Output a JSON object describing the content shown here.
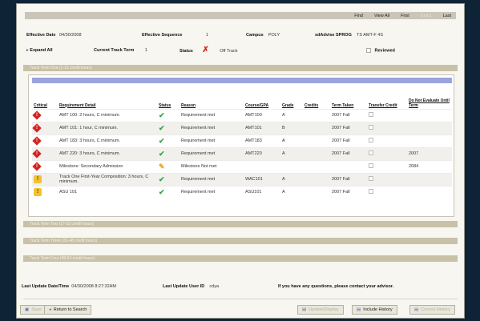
{
  "nav": {
    "find": "Find",
    "view_all": "View All",
    "first": "First",
    "counter": "1 of 1",
    "last": "Last"
  },
  "header": {
    "effective_date_label": "Effective Date",
    "effective_date": "04/30/2008",
    "effective_sequence_label": "Effective Sequence",
    "effective_sequence": "1",
    "campus_label": "Campus",
    "campus": "POLY",
    "sdadvise_label": "sdAdvise SPROG",
    "sdadvise": "TS AMT-F 4S",
    "expand_all": "Expand All",
    "current_track_term_label": "Current Track Term",
    "current_track_term": "1",
    "status_label": "Status",
    "status_value": "Off Track",
    "reviewed_label": "Reviewed"
  },
  "terms": {
    "one": "Track Term One (1-15 credit hours)",
    "two": "Track Term Two (17-33 credit hours)",
    "three": "Track Term Three (31-48 credit hours)",
    "four": "Track Term Four (49-64 credit hours)"
  },
  "table": {
    "headers": {
      "critical": "Critical",
      "requirement": "Requirement Detail",
      "status": "Status",
      "reason": "Reason",
      "course": "Course/GPA",
      "grade": "Grade",
      "credits": "Credits",
      "term_taken": "Term Taken",
      "transfer": "Transfer Credit",
      "do_not_evaluate": "Do Not Evaluate Until Term"
    },
    "rows": [
      {
        "requirement": "AMT 100: 2 hours, C minimum.",
        "reason": "Requirement met",
        "course": "AMT100",
        "grade": "A",
        "term": "2007 Fall",
        "until": ""
      },
      {
        "requirement": "AMT 101: 1 hour, C minimum.",
        "reason": "Requirement met",
        "course": "AMT101",
        "grade": "B",
        "term": "2007 Fall",
        "until": ""
      },
      {
        "requirement": "AMT 183: 3 hours, C minimum.",
        "reason": "Requirement met",
        "course": "AMT183",
        "grade": "A",
        "term": "2007 Fall",
        "until": ""
      },
      {
        "requirement": "AMT 220: 3 hours, C minimum.",
        "reason": "Requirement met",
        "course": "AMT220",
        "grade": "A",
        "term": "2007 Fall",
        "until": "2007"
      },
      {
        "requirement": "Milestone: Secondary Admission",
        "reason": "Milestone Not met",
        "course": "",
        "grade": "",
        "term": "",
        "until": "2084"
      },
      {
        "requirement": "Track One First-Year Composition: 3 hours, C minimum.",
        "reason": "Requirement met",
        "course": "WAC101",
        "grade": "A",
        "term": "2007 Fall",
        "until": ""
      },
      {
        "requirement": "ASU 101",
        "reason": "Requirement met",
        "course": "ASU101",
        "grade": "A",
        "term": "2007 Fall",
        "until": ""
      }
    ]
  },
  "footer": {
    "last_update_label": "Last Update Date/Time",
    "last_update": "04/30/2008 8:27:32AM",
    "last_user_label": "Last Update User ID",
    "last_user": "cdya",
    "contact": "If you have any questions, please contact your advisor."
  },
  "buttons": {
    "save": "Save",
    "return": "Return to Search",
    "update_display": "Update/Display",
    "include_history": "Include History",
    "correct_history": "Correct History"
  }
}
